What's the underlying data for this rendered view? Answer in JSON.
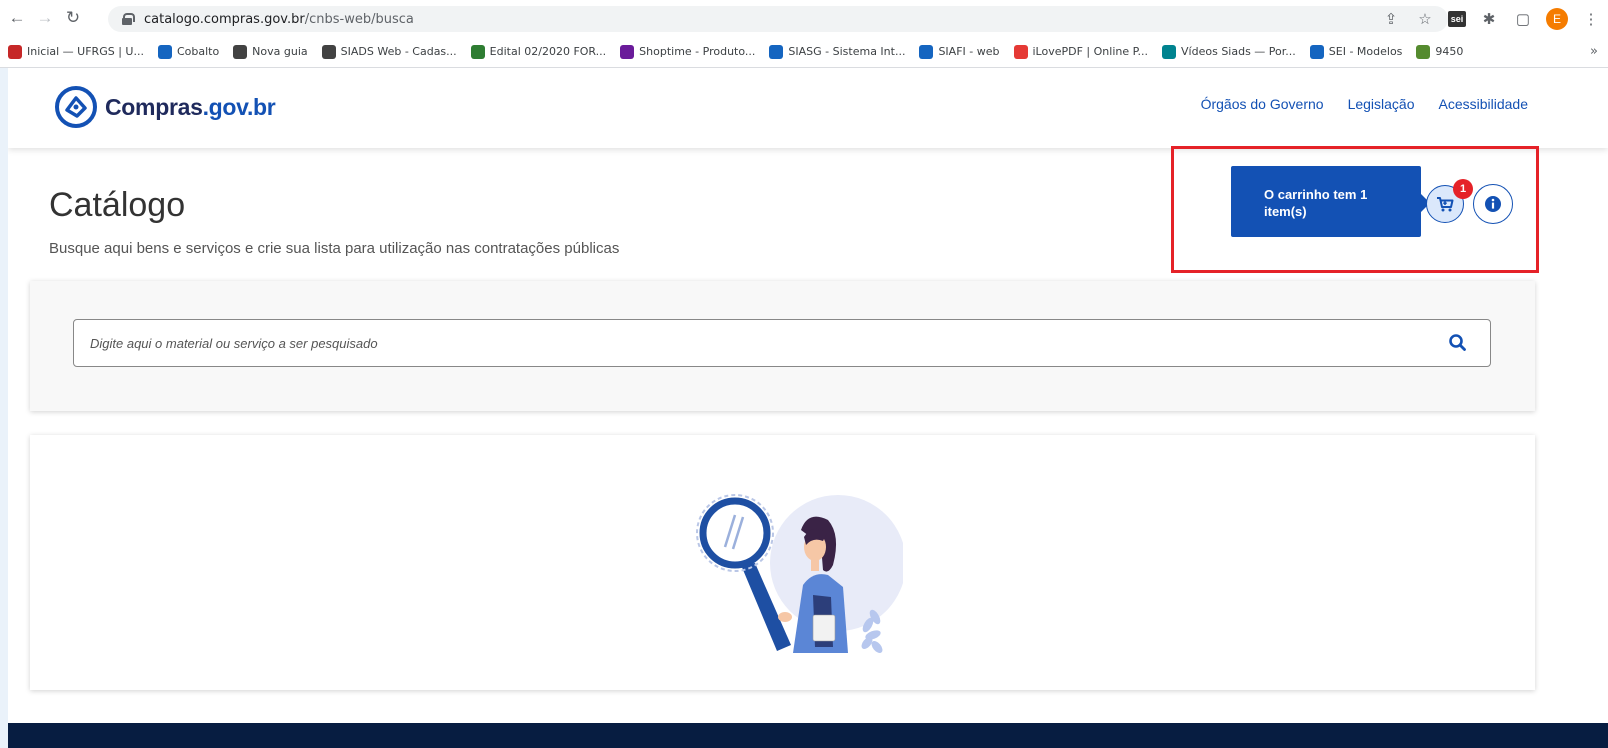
{
  "browser": {
    "url_domain": "catalogo.compras.gov.br",
    "url_path": "/cnbs-web/busca",
    "bookmarks": [
      {
        "label": "Inicial — UFRGS | U...",
        "color": "#c62828"
      },
      {
        "label": "Cobalto",
        "color": "#1565c0"
      },
      {
        "label": "Nova guia",
        "color": "#424242"
      },
      {
        "label": "SIADS Web - Cadas...",
        "color": "#424242"
      },
      {
        "label": "Edital 02/2020 FOR...",
        "color": "#2e7d32"
      },
      {
        "label": "Shoptime - Produto...",
        "color": "#6a1b9a"
      },
      {
        "label": "SIASG - Sistema Int...",
        "color": "#1565c0"
      },
      {
        "label": "SIAFI - web",
        "color": "#1565c0"
      },
      {
        "label": "iLovePDF | Online P...",
        "color": "#e53935"
      },
      {
        "label": "Vídeos Siads — Por...",
        "color": "#00838f"
      },
      {
        "label": "SEI - Modelos",
        "color": "#1565c0"
      },
      {
        "label": "9450",
        "color": "#558b2f"
      }
    ],
    "bookmark_prefix_sei": "sei",
    "more_bookmarks": "»",
    "avatar_letter": "E",
    "sei_ext": "sei"
  },
  "header": {
    "logo_brand": "Compras",
    "logo_domain": ".gov.br",
    "nav": [
      "Órgãos do Governo",
      "Legislação",
      "Acessibilidade"
    ]
  },
  "main": {
    "title": "Catálogo",
    "subtitle": "Busque aqui bens e serviços e crie sua lista para utilização nas contratações públicas"
  },
  "cart": {
    "tooltip": "O carrinho tem 1 item(s)",
    "badge_count": "1"
  },
  "search": {
    "placeholder": "Digite aqui o material ou serviço a ser pesquisado"
  },
  "colors": {
    "primary": "#1351b4",
    "highlight_box": "#e52228",
    "footer": "#071d41"
  }
}
